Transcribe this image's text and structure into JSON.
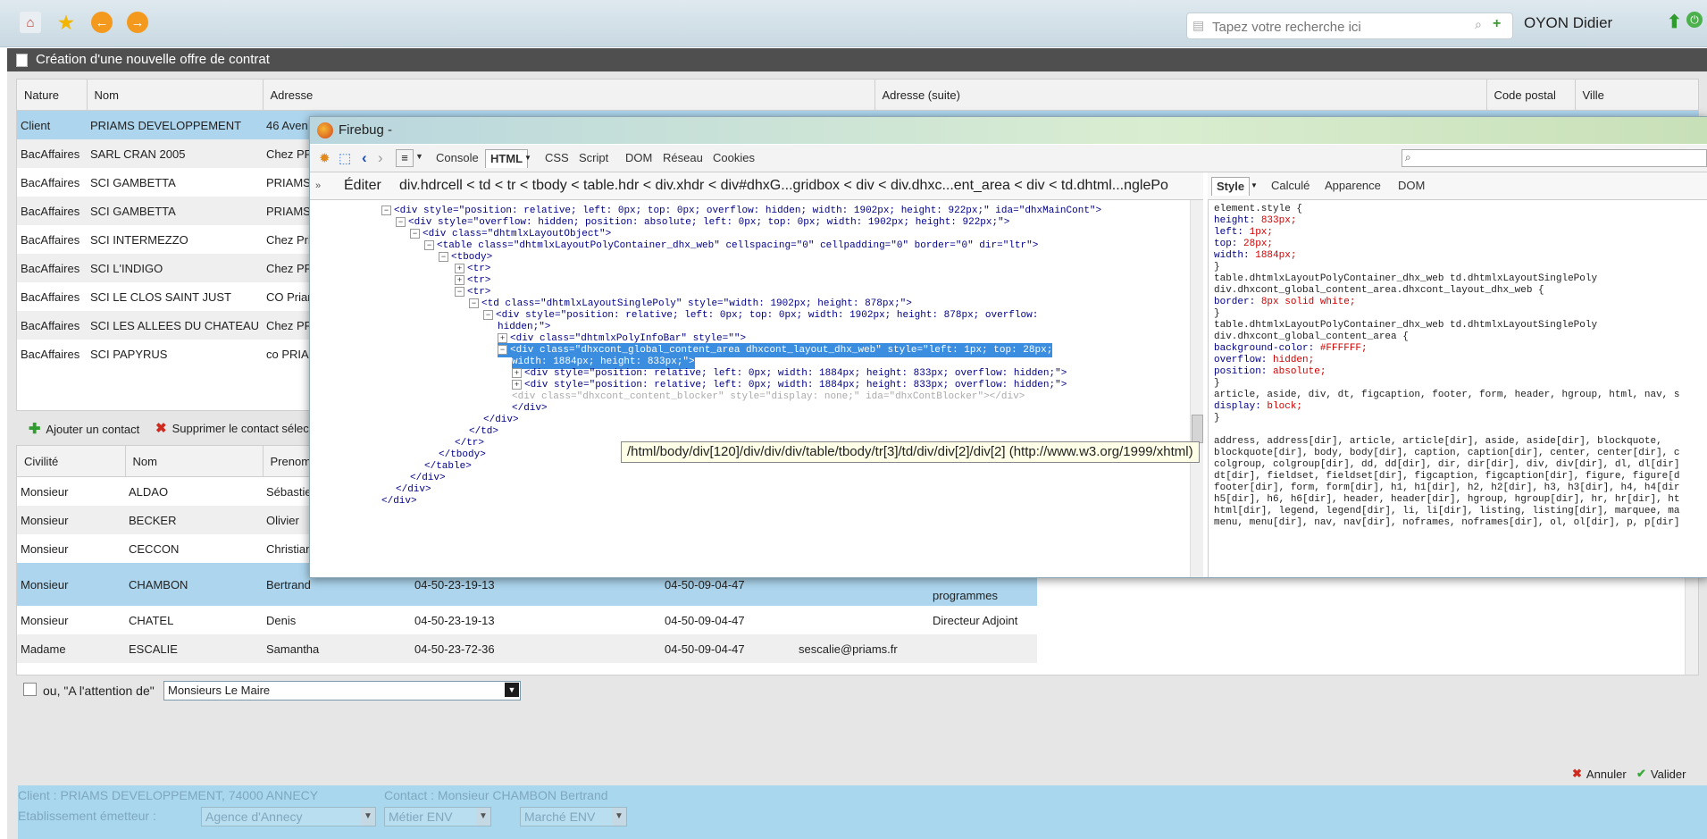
{
  "topbar": {
    "search_placeholder": "Tapez votre recherche ici",
    "user_name": "OYON Didier"
  },
  "panel": {
    "title": "Création d'une nouvelle offre de contrat"
  },
  "clients_grid": {
    "columns": [
      "Nature",
      "Nom",
      "Adresse",
      "Adresse (suite)",
      "Code postal",
      "Ville"
    ],
    "rows": [
      {
        "nature": "Client",
        "nom": "PRIAMS DEVELOPPEMENT",
        "adresse": "46 Aven"
      },
      {
        "nature": "BacAffaires",
        "nom": "SARL CRAN 2005",
        "adresse": "Chez PRI"
      },
      {
        "nature": "BacAffaires",
        "nom": "SCI GAMBETTA",
        "adresse": "PRIAMS"
      },
      {
        "nature": "BacAffaires",
        "nom": "SCI GAMBETTA",
        "adresse": "PRIAMS"
      },
      {
        "nature": "BacAffaires",
        "nom": "SCI INTERMEZZO",
        "adresse": "Chez Pri"
      },
      {
        "nature": "BacAffaires",
        "nom": "SCI L'INDIGO",
        "adresse": "Chez PRI"
      },
      {
        "nature": "BacAffaires",
        "nom": "SCI LE CLOS SAINT JUST",
        "adresse": "CO Priam"
      },
      {
        "nature": "BacAffaires",
        "nom": "SCI LES ALLEES DU CHATEAU",
        "adresse": "Chez PRI"
      },
      {
        "nature": "BacAffaires",
        "nom": "SCI PAPYRUS",
        "adresse": "co PRIA"
      }
    ]
  },
  "contact_toolbar": {
    "add_label": "Ajouter un contact",
    "delete_label": "Supprimer le contact sélect"
  },
  "contacts_grid": {
    "columns": [
      "Civilité",
      "Nom",
      "Prenom"
    ],
    "rows": [
      {
        "civilite": "Monsieur",
        "nom": "ALDAO",
        "prenom": "Sébastien",
        "tel": "",
        "fax": "",
        "email": "",
        "fonction": ""
      },
      {
        "civilite": "Monsieur",
        "nom": "BECKER",
        "prenom": "Olivier",
        "tel": "",
        "fax": "",
        "email": "",
        "fonction": ""
      },
      {
        "civilite": "Monsieur",
        "nom": "CECCON",
        "prenom": "Christian",
        "tel": "",
        "fax": "",
        "email": "",
        "fonction": ""
      },
      {
        "civilite": "Monsieur",
        "nom": "CHAMBON",
        "prenom": "Bertrand",
        "tel": "04-50-23-19-13",
        "fax": "04-50-09-04-47",
        "email": "",
        "fonction": "programmes"
      },
      {
        "civilite": "Monsieur",
        "nom": "CHATEL",
        "prenom": "Denis",
        "tel": "04-50-23-19-13",
        "fax": "04-50-09-04-47",
        "email": "",
        "fonction": "Directeur Adjoint"
      },
      {
        "civilite": "Madame",
        "nom": "ESCALIE",
        "prenom": "Samantha",
        "tel": "04-50-23-72-36",
        "fax": "04-50-09-04-47",
        "email": "sescalie@priams.fr",
        "fonction": ""
      }
    ]
  },
  "attention": {
    "label": "ou, \"A l'attention de\"",
    "value": "Monsieurs Le Maire"
  },
  "actions": {
    "cancel_label": "Annuler",
    "validate_label": "Valider"
  },
  "footer": {
    "client_text": "Client : PRIAMS DEVELOPPEMENT, 74000 ANNECY",
    "contact_text": "Contact : Monsieur CHAMBON Bertrand",
    "etablissement_label": "Etablissement émetteur :",
    "agence_value": "Agence d'Annecy",
    "metier_value": "Métier ENV",
    "marche_value": "Marché ENV"
  },
  "firebug": {
    "title": "Firebug -",
    "tabs": [
      "Console",
      "HTML",
      "CSS",
      "Script",
      "DOM",
      "Réseau",
      "Cookies"
    ],
    "active_tab": "HTML",
    "edit_label": "Éditer",
    "breadcrumb": "div.hdrcell < td < tr < tbody < table.hdr < div.xhdr < div#dhxG...gridbox < div < div.dhxc...ent_area < div < td.dhtml...nglePo",
    "side_tabs": [
      "Style",
      "Calculé",
      "Apparence",
      "DOM"
    ],
    "active_side_tab": "Style",
    "tooltip": "/html/body/div[120]/div/div/div/table/tbody/tr[3]/td/div/div[2]/div[2] (http://www.w3.org/1999/xhtml)",
    "html_lines": [
      {
        "t": "-",
        "text": "<div style=\"position: relative; left: 0px; top: 0px; overflow: hidden; width: 1902px; height: 922px;\" ida=\"dhxMainCont\">"
      },
      {
        "t": "-",
        "text": "<div style=\"overflow: hidden; position: absolute; left: 0px; top: 0px; width: 1902px; height: 922px;\">"
      },
      {
        "t": "-",
        "text": "<div class=\"dhtmlxLayoutObject\">"
      },
      {
        "t": "-",
        "text": "<table class=\"dhtmlxLayoutPolyContainer_dhx_web\" cellspacing=\"0\" cellpadding=\"0\" border=\"0\" dir=\"ltr\">"
      },
      {
        "t": "-",
        "text": "<tbody>"
      },
      {
        "t": "+",
        "text": "<tr>"
      },
      {
        "t": "+",
        "text": "<tr>"
      },
      {
        "t": "-",
        "text": "<tr>"
      },
      {
        "t": "-",
        "text": "<td class=\"dhtmlxLayoutSinglePoly\" style=\"width: 1902px; height: 878px;\">"
      },
      {
        "t": "-",
        "text": "<div style=\"position: relative; left: 0px; top: 0px; width: 1902px; height: 878px; overflow:"
      },
      {
        "t": "",
        "text": "hidden;\">"
      },
      {
        "t": "+",
        "text": "<div class=\"dhtmlxPolyInfoBar\" style=\"\">"
      },
      {
        "t": "-",
        "text": "<div class=\"dhxcont_global_content_area dhxcont_layout_dhx_web\" style=\"left: 1px; top: 28px;"
      },
      {
        "t": "",
        "text": "width: 1884px; height: 833px;\">"
      },
      {
        "t": "+",
        "text": "<div style=\"position: relative; left: 0px; width: 1884px; height: 833px; overflow: hidden;\">"
      },
      {
        "t": "+",
        "text": "<div style=\"position: relative; left: 0px; width: 1884px; height: 833px; overflow: hidden;\">"
      },
      {
        "t": "",
        "text": "<div class=\"dhxcont_content_blocker\" style=\"display: none;\" ida=\"dhxContBlocker\"></div>"
      },
      {
        "t": "",
        "text": "</div>"
      },
      {
        "t": "",
        "text": "</div>"
      },
      {
        "t": "",
        "text": "</td>"
      },
      {
        "t": "",
        "text": "</tr>"
      },
      {
        "t": "",
        "text": "</tbody>"
      },
      {
        "t": "",
        "text": "</table>"
      },
      {
        "t": "",
        "text": "</div>"
      },
      {
        "t": "",
        "text": "</div>"
      },
      {
        "t": "",
        "text": "</div>"
      }
    ],
    "style_lines": [
      "element.style {",
      "    height: 833px;",
      "    left: 1px;",
      "    top: 28px;",
      "    width: 1884px;",
      "}",
      "table.dhtmlxLayoutPolyContainer_dhx_web td.dhtmlxLayoutSinglePoly",
      "div.dhxcont_global_content_area.dhxcont_layout_dhx_web {",
      "    border: 8px solid white;",
      "}",
      "table.dhtmlxLayoutPolyContainer_dhx_web td.dhtmlxLayoutSinglePoly",
      "div.dhxcont_global_content_area {",
      "    background-color: #FFFFFF;",
      "    overflow: hidden;",
      "    position: absolute;",
      "}",
      "article, aside, div, dt, figcaption, footer, form, header, hgroup, html, nav, s",
      "    display: block;",
      "}",
      "",
      "address, address[dir], article, article[dir], aside, aside[dir], blockquote,",
      "blockquote[dir], body, body[dir], caption, caption[dir], center, center[dir], c",
      "colgroup, colgroup[dir], dd, dd[dir], dir, dir[dir], div, div[dir], dl, dl[dir]",
      "dt[dir], fieldset, fieldset[dir], figcaption, figcaption[dir], figure, figure[d",
      "footer[dir], form, form[dir], h1, h1[dir], h2, h2[dir], h3, h3[dir], h4, h4[dir",
      "h5[dir], h6, h6[dir], header, header[dir], hgroup, hgroup[dir], hr, hr[dir], ht",
      "html[dir], legend, legend[dir], li, li[dir], listing, listing[dir], marquee, ma",
      "menu, menu[dir], nav, nav[dir], noframes, noframes[dir], ol, ol[dir], p, p[dir]"
    ]
  }
}
